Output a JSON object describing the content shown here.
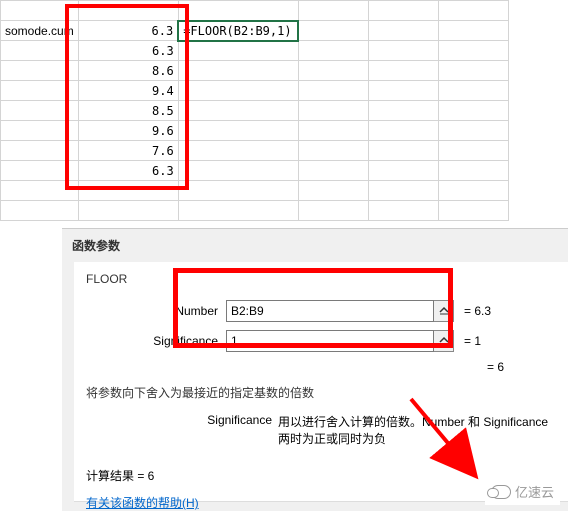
{
  "watermark": "somode.cum",
  "cells": {
    "b": [
      "6.3",
      "6.3",
      "8.6",
      "9.4",
      "8.5",
      "9.6",
      "7.6",
      "6.3"
    ],
    "formula": "=FLOOR(B2:B9,1)"
  },
  "dialog": {
    "title": "函数参数",
    "fn_name": "FLOOR",
    "params": {
      "number_label": "Number",
      "number_value": "B2:B9",
      "number_result": "=  6.3",
      "sig_label": "Significance",
      "sig_value": "1",
      "sig_result": "=  1"
    },
    "extra_result": "=  6",
    "desc_main": "将参数向下舍入为最接近的指定基数的倍数",
    "desc_param_label": "Significance",
    "desc_param_text": "用以进行舍入计算的倍数。Number 和 Significance 两时为正或同时为负",
    "calc_result": "计算结果 =  6",
    "help_link": "有关该函数的帮助(H)"
  },
  "brand": "亿速云"
}
